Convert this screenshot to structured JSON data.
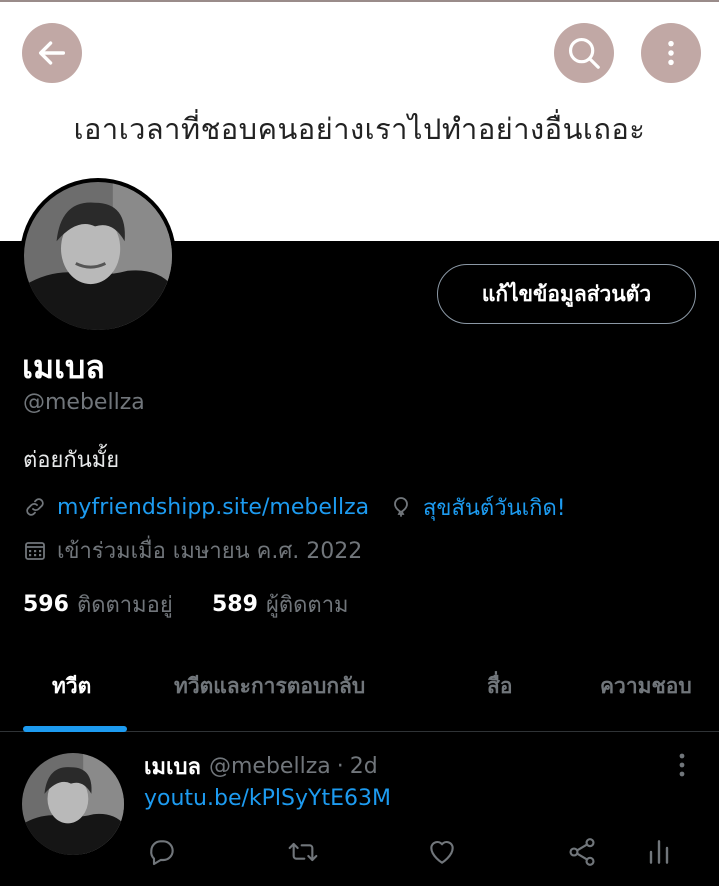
{
  "banner": {
    "text": "เอาเวลาที่ชอบคนอย่างเราไปทำอย่างอื่นเถอะ",
    "background": "#ffffff",
    "button_color": "#c1a8a5",
    "buttons": {
      "back_icon": "arrow-left-icon",
      "search_icon": "search-icon",
      "more_icon": "more-vertical-icon"
    }
  },
  "profile": {
    "edit_label": "แก้ไขข้อมูลส่วนตัว",
    "name": "เมเบล",
    "handle": "@mebellza",
    "bio": "ต่อยกันมั้ย",
    "website": "myfriendshipp.site/mebellza",
    "birthday": "สุขสันต์วันเกิด!",
    "joined": "เข้าร่วมเมื่อ เมษายน ค.ศ. 2022",
    "following_count": "596",
    "following_label": "ติดตามอยู่",
    "followers_count": "589",
    "followers_label": "ผู้ติดตาม"
  },
  "tabs": [
    {
      "label": "ทวีต",
      "active": true
    },
    {
      "label": "ทวีตและการตอบกลับ",
      "active": false
    },
    {
      "label": "สื่อ",
      "active": false
    },
    {
      "label": "ความชอบ",
      "active": false
    }
  ],
  "tweet": {
    "name": "เมเบล",
    "handle": "@mebellza",
    "time": "2d",
    "separator": "·",
    "link": "youtu.be/kPlSyYtE63M",
    "actions": [
      "reply-icon",
      "retweet-icon",
      "like-icon",
      "share-icon",
      "analytics-icon"
    ]
  },
  "colors": {
    "accent": "#1d9bf0",
    "muted": "#71767b",
    "background": "#000000"
  }
}
